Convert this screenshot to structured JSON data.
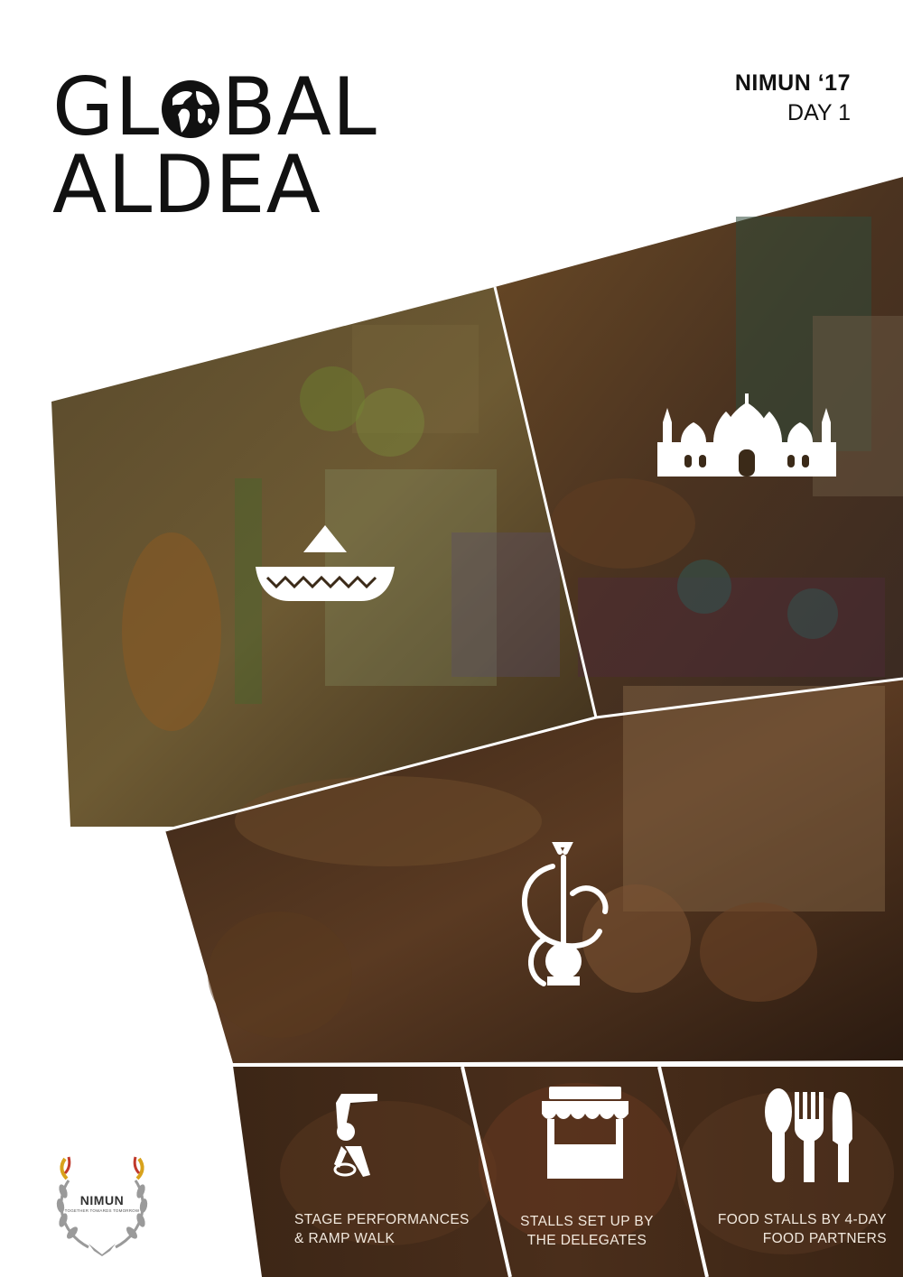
{
  "header": {
    "title_line1": "GL",
    "title_line1_rest": "BAL",
    "title_line2": "ALDEA",
    "edition": "NIMUN ‘17",
    "day": "DAY 1"
  },
  "collage": {
    "panels": [
      "mexico-stall-photo",
      "pakistan-stall-photo",
      "middle-east-stall-photo"
    ],
    "icons": [
      "sombrero-icon",
      "mosque-icon",
      "hookah-icon"
    ]
  },
  "highlights": [
    {
      "icon": "breakdance-icon",
      "line1": "STAGE PERFORMANCES",
      "line2": "& RAMP WALK"
    },
    {
      "icon": "stall-icon",
      "line1": "STALLS SET UP BY",
      "line2": "THE DELEGATES"
    },
    {
      "icon": "cutlery-icon",
      "line1": "FOOD STALLS BY 4-DAY",
      "line2": "FOOD PARTNERS"
    }
  ],
  "logo": {
    "name": "NIMUN",
    "tagline": "TOGETHER TOWARDS TOMORROW"
  },
  "colors": {
    "background": "#ffffff",
    "overlay_brown": "#3a2414",
    "text_dark": "#111111",
    "icon_white": "#ffffff"
  }
}
